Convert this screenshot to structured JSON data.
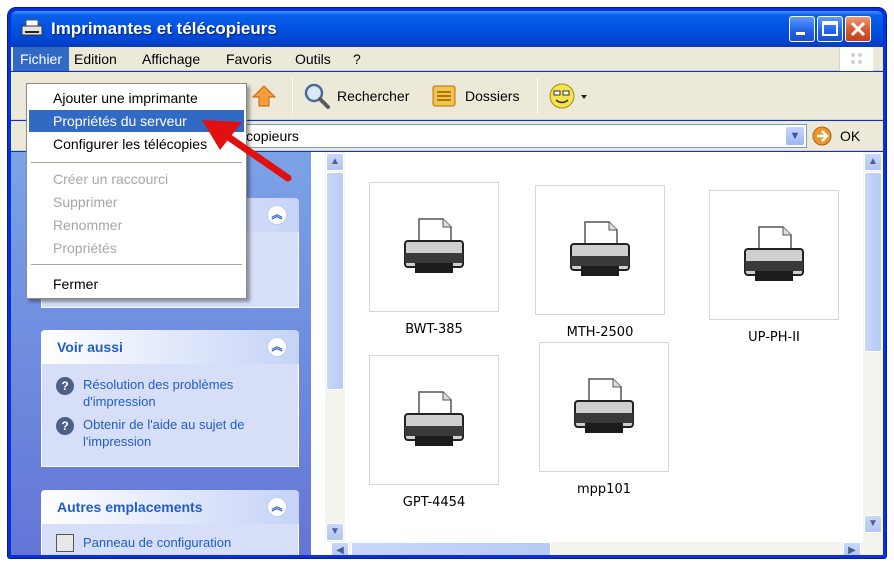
{
  "window": {
    "title": "Imprimantes et télécopieurs",
    "icon": "printer-icon",
    "controls": [
      "minimize-icon",
      "maximize-icon",
      "close-icon"
    ]
  },
  "menubar": {
    "items": [
      "Fichier",
      "Edition",
      "Affichage",
      "Favoris",
      "Outils",
      "?"
    ]
  },
  "toolbar": {
    "search_label": "Rechercher",
    "folders_label": "Dossiers"
  },
  "addressbar": {
    "value": "copieurs",
    "go_label": "OK"
  },
  "file_menu": {
    "items": [
      {
        "label": "Ajouter une imprimante",
        "state": "normal"
      },
      {
        "label": "Propriétés du serveur",
        "state": "highlighted"
      },
      {
        "label": "Configurer les télécopies",
        "state": "normal"
      },
      {
        "label": "Créer un raccourci",
        "state": "disabled"
      },
      {
        "label": "Supprimer",
        "state": "disabled"
      },
      {
        "label": "Renommer",
        "state": "disabled"
      },
      {
        "label": "Propriétés",
        "state": "disabled"
      },
      {
        "label": "Fermer",
        "state": "normal"
      }
    ]
  },
  "taskpane": {
    "see_also": {
      "title": "Voir aussi",
      "links": [
        "Résolution des problèmes d'impression",
        "Obtenir de l'aide au sujet de l'impression"
      ]
    },
    "other_places": {
      "title": "Autres emplacements",
      "links": [
        "Panneau de configuration"
      ]
    }
  },
  "printers": [
    "BWT-385",
    "MTH-2500",
    "UP-PH-II",
    "GPT-4454",
    "mpp101"
  ],
  "colors": {
    "titlebar": "#0054e3",
    "highlight": "#316ac5",
    "taskpane_link": "#215dc6",
    "annotation_arrow": "#e01010"
  }
}
